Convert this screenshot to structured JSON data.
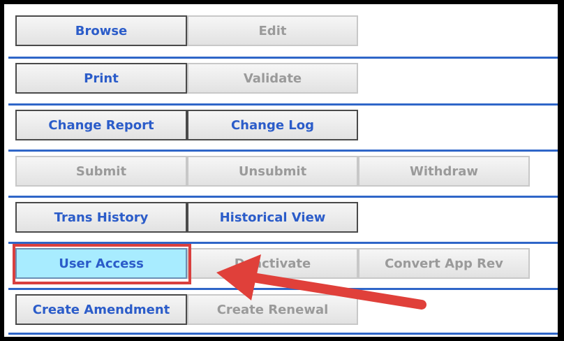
{
  "rows": [
    {
      "buttons": [
        {
          "label": "Browse",
          "state": "enabled"
        },
        {
          "label": "Edit",
          "state": "disabled"
        }
      ]
    },
    {
      "buttons": [
        {
          "label": "Print",
          "state": "enabled"
        },
        {
          "label": "Validate",
          "state": "disabled"
        }
      ]
    },
    {
      "buttons": [
        {
          "label": "Change Report",
          "state": "enabled"
        },
        {
          "label": "Change Log",
          "state": "enabled"
        }
      ]
    },
    {
      "buttons": [
        {
          "label": "Submit",
          "state": "disabled"
        },
        {
          "label": "Unsubmit",
          "state": "disabled"
        },
        {
          "label": "Withdraw",
          "state": "disabled"
        }
      ]
    },
    {
      "buttons": [
        {
          "label": "Trans History",
          "state": "enabled"
        },
        {
          "label": "Historical View",
          "state": "enabled"
        }
      ]
    },
    {
      "buttons": [
        {
          "label": "User Access",
          "state": "selected"
        },
        {
          "label": "Deactivate",
          "state": "disabled"
        },
        {
          "label": "Convert App Rev",
          "state": "disabled"
        }
      ]
    },
    {
      "buttons": [
        {
          "label": "Create Amendment",
          "state": "enabled"
        },
        {
          "label": "Create Renewal",
          "state": "disabled"
        }
      ]
    }
  ],
  "annotation": {
    "highlight_color": "#d9403f",
    "arrow_color": "#e0403a",
    "target": "User Access"
  },
  "colors": {
    "enabled_text": "#2b5cc9",
    "disabled_text": "#9a9a9a",
    "selected_bg": "#a8ecff",
    "rule": "#2f66c8"
  }
}
